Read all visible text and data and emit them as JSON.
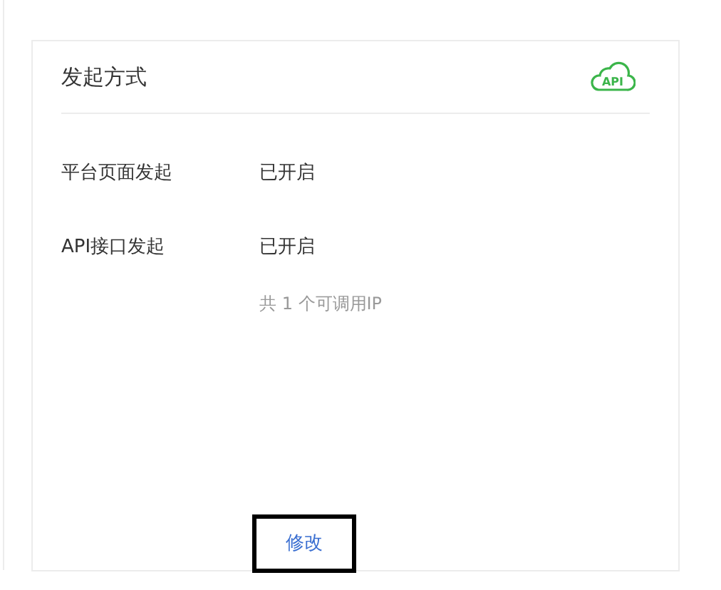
{
  "card": {
    "title": "发起方式",
    "badge": "API",
    "rows": [
      {
        "label": "平台页面发起",
        "value": "已开启"
      },
      {
        "label": "API接口发起",
        "value": "已开启",
        "note": "共 1 个可调用IP"
      }
    ],
    "button": "修改"
  }
}
